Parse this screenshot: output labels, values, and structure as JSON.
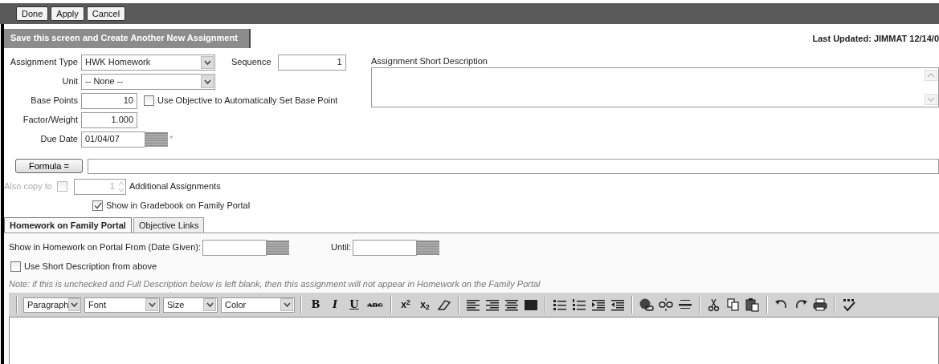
{
  "top_buttons": [
    "Done",
    "Apply",
    "Cancel"
  ],
  "save_another_button": "Save this screen and Create Another New Assignment",
  "last_updated": "Last Updated: JIMMAT 12/14/0",
  "assignment_type": {
    "label": "Assignment Type",
    "value": "HWK Homework"
  },
  "sequence": {
    "label": "Sequence",
    "value": "1"
  },
  "unit": {
    "label": "Unit",
    "value": "-- None --"
  },
  "base_points": {
    "label": "Base Points",
    "value": "10"
  },
  "use_objective": {
    "label": "Use Objective to Automatically Set Base Point",
    "checked": false
  },
  "factor_weight": {
    "label": "Factor/Weight",
    "value": "1.000"
  },
  "due_date": {
    "label": "Due Date",
    "value": "01/04/07",
    "required_mark": "*"
  },
  "short_description": {
    "label": "Assignment Short Description"
  },
  "formula": {
    "button": "Formula ="
  },
  "also_copy": {
    "label": "Also copy to",
    "checked": false,
    "disabled": true,
    "count": "1",
    "suffix": "Additional Assignments"
  },
  "show_in_gradebook": {
    "label": "Show in Gradebook on Family Portal",
    "checked": true
  },
  "tabs": [
    {
      "label": "Homework on Family Portal",
      "selected": true
    },
    {
      "label": "Objective Links",
      "selected": false
    }
  ],
  "portal_from": {
    "label": "Show in Homework on Portal From (Date Given):"
  },
  "until": {
    "label": "Until:"
  },
  "use_short_description": {
    "label": "Use Short Description from above",
    "checked": false
  },
  "note": "Note: if this is unchecked and Full Description below is left blank, then this assignment will not appear in Homework on the Family Portal",
  "editor": {
    "selects": [
      "Paragraph",
      "Font",
      "Size",
      "Color"
    ],
    "format_glyphs": [
      "B",
      "I",
      "U",
      "ABC",
      "x$^{2}$",
      "x$_{2}$"
    ]
  }
}
